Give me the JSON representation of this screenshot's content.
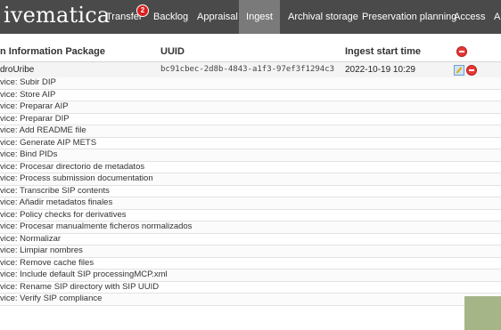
{
  "nav": {
    "brand": "ivematica",
    "items": [
      {
        "label": "Transfer",
        "badge": "2"
      },
      {
        "label": "Backlog"
      },
      {
        "label": "Appraisal"
      },
      {
        "label": "Ingest",
        "active": true
      },
      {
        "label": "Archival storage"
      },
      {
        "label": "Preservation planning"
      },
      {
        "label": "Access"
      },
      {
        "label": "A"
      }
    ]
  },
  "table": {
    "headers": {
      "name": "n Information Package",
      "uuid": "UUID",
      "start": "Ingest start time"
    },
    "sip": {
      "name": "droUribe",
      "uuid": "bc91cbec-2d8b-4843-a1f3-97ef3f1294c3",
      "start": "2022-10-19 10:29"
    },
    "microservices": [
      "vice: Subir DIP",
      "vice: Store AIP",
      "vice: Preparar AIP",
      "vice: Preparar DIP",
      "vice: Add README file",
      "vice: Generate AIP METS",
      "vice: Bind PIDs",
      "vice: Procesar directorio de metadatos",
      "vice: Process submission documentation",
      "vice: Transcribe SIP contents",
      "vice: Añadir metadatos finales",
      "vice: Policy checks for derivatives",
      "vice: Procesar manualmente ficheros normalizados",
      "vice: Normalizar",
      "vice: Limpiar nombres",
      "vice: Remove cache files",
      "vice: Include default SIP processingMCP.xml",
      "vice: Rename SIP directory with SIP UUID",
      "vice: Verify SIP compliance"
    ]
  }
}
